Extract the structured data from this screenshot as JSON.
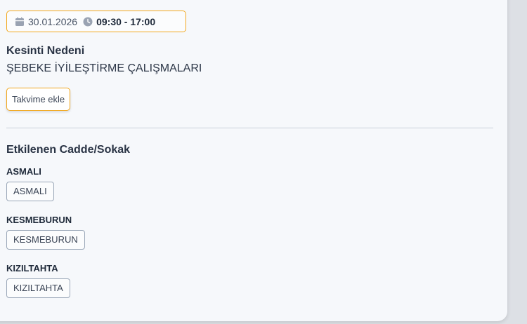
{
  "outage": {
    "date": "30.01.2026",
    "time_range": "09:30 - 17:00",
    "reason_label": "Kesinti Nedeni",
    "reason_value": "ŞEBEKE İYİLEŞTİRME ÇALIŞMALARI",
    "add_to_calendar_label": "Takvime ekle"
  },
  "affected": {
    "title": "Etkilenen Cadde/Sokak",
    "streets": [
      {
        "name": "ASMALI",
        "chip": "ASMALI"
      },
      {
        "name": "KESMEBURUN",
        "chip": "KESMEBURUN"
      },
      {
        "name": "KIZILTAHTA",
        "chip": "KIZILTAHTA"
      }
    ]
  },
  "colors": {
    "accent": "#f2a81e",
    "icon": "#9aa3b2"
  },
  "icons": [
    "calendar-icon",
    "clock-icon"
  ]
}
